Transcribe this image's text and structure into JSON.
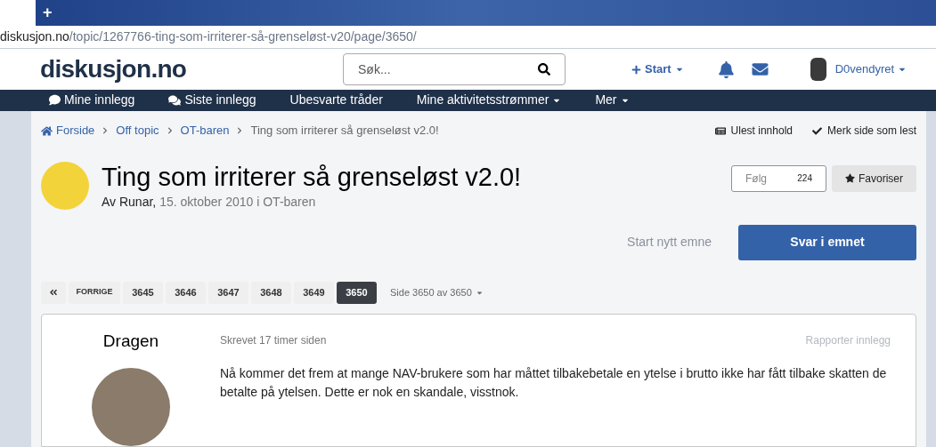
{
  "browser": {
    "tab_new": "+",
    "url_domain": "diskusjon.no",
    "url_path": "/topic/1267766-ting-som-irriterer-så-grenseløst-v20/page/3650/"
  },
  "header": {
    "logo": "diskusjon.no",
    "search_placeholder": "Søk...",
    "start_label": "Start",
    "username": "D0vendyret"
  },
  "nav": [
    {
      "label": "Mine innlegg",
      "kind": "comment"
    },
    {
      "label": "Siste innlegg",
      "kind": "comments"
    },
    {
      "label": "Ubesvarte tråder",
      "kind": "plain"
    },
    {
      "label": "Mine aktivitetsstrømmer",
      "kind": "dropdown"
    },
    {
      "label": "Mer",
      "kind": "dropdown"
    }
  ],
  "breadcrumb": [
    {
      "label": "Forside",
      "kind": "home"
    },
    {
      "label": "Off topic",
      "kind": "link"
    },
    {
      "label": "OT-baren",
      "kind": "link"
    },
    {
      "label": "Ting som irriterer så grenseløst v2.0!",
      "kind": "current"
    }
  ],
  "page_actions": [
    {
      "label": "Ulest innhold",
      "kind": "unread"
    },
    {
      "label": "Merk side som lest",
      "kind": "check"
    }
  ],
  "topic": {
    "title": "Ting som irriterer så grenseløst v2.0!",
    "byline": "Av Runar,",
    "meta": "15. oktober 2010 i OT-baren",
    "follow_label": "Følg",
    "follow_count": "224",
    "favorite_label": "Favoriser",
    "start_topic": "Start nytt emne",
    "reply": "Svar i emnet"
  },
  "pagination": {
    "prev": "FORRIGE",
    "pages": [
      {
        "label": "3645",
        "selected": false
      },
      {
        "label": "3646",
        "selected": false
      },
      {
        "label": "3647",
        "selected": false
      },
      {
        "label": "3648",
        "selected": false
      },
      {
        "label": "3649",
        "selected": false
      },
      {
        "label": "3650",
        "selected": true
      }
    ],
    "info": "Side 3650 av 3650"
  },
  "post": {
    "author": "Dragen",
    "time": "Skrevet 17 timer siden",
    "report": "Rapporter innlegg",
    "body": "Nå kommer det frem at mange NAV-brukere som har måttet tilbakebetale en ytelse i brutto ikke har fått tilbake skatten de betalte på ytelsen. Dette er nok en skandale, visstnok."
  }
}
